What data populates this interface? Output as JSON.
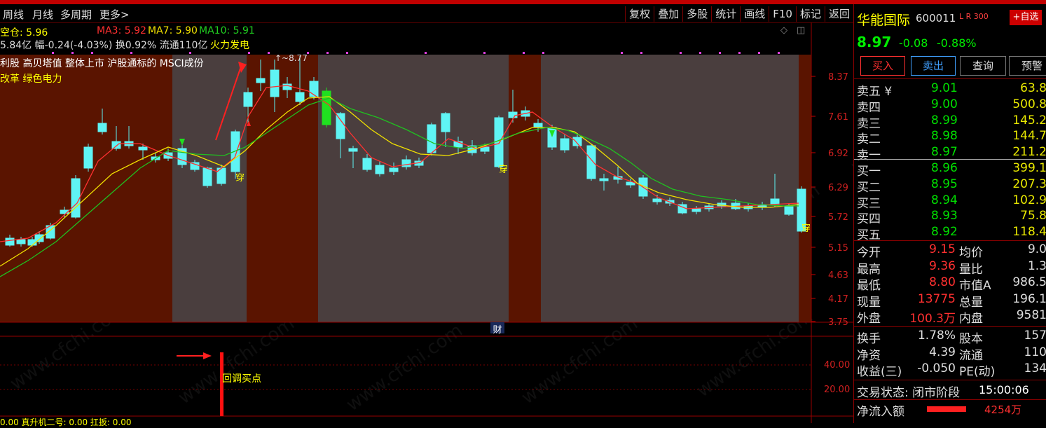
{
  "toolbar": {
    "left": [
      "周线",
      "月线",
      "多周期",
      "更多>"
    ],
    "right": [
      "复权",
      "叠加",
      "多股",
      "统计",
      "画线",
      "F10",
      "标记",
      "返回"
    ]
  },
  "info1": {
    "pos": "空仓: 5.96",
    "ma3": "MA3: 5.92",
    "ma7": "MA7: 5.90",
    "ma10": "MA10: 5.91"
  },
  "info2": {
    "text": "5.84亿 幅-0.24(-4.03%) 换0.92% 流通110亿",
    "sector": "火力发电"
  },
  "tags1": "利股 高贝塔值 整体上市 沪股通标的 MSCI成份",
  "tags2": "改革 绿色电力",
  "chart_data": {
    "type": "candlestick",
    "price_axis": [
      "8.37",
      "7.61",
      "6.92",
      "6.29",
      "5.72",
      "5.15",
      "4.63",
      "4.17",
      "3.75"
    ],
    "high_label": "8.77",
    "markers": [
      "穿",
      "穿",
      "穿"
    ],
    "finance_marker": "财",
    "indicator_axis": [
      "40.00",
      "20.00"
    ],
    "indicator_label": "回调买点",
    "bottom_indicators": "0.00  真升机二号: 0.00   扛扳: 0.00",
    "colors": {
      "up": "#ff2020",
      "down": "#5ff4f4",
      "ma3": "#ff3030",
      "ma7": "#f0e000",
      "ma10": "#20c020"
    }
  },
  "quote": {
    "name": "华能国际",
    "code": "600011",
    "flags": "L R 300",
    "add": "+自选",
    "price": "8.97",
    "change": "-0.08",
    "pct": "-0.88%",
    "buttons": [
      "买入",
      "卖出",
      "查询",
      "预警"
    ],
    "sell": [
      {
        "label": "卖五 ¥",
        "price": "9.01",
        "vol": "63.8"
      },
      {
        "label": "卖四",
        "price": "9.00",
        "vol": "500.8"
      },
      {
        "label": "卖三",
        "price": "8.99",
        "vol": "145.2"
      },
      {
        "label": "卖二",
        "price": "8.98",
        "vol": "144.7"
      },
      {
        "label": "卖一",
        "price": "8.97",
        "vol": "211.2"
      }
    ],
    "buy": [
      {
        "label": "买一",
        "price": "8.96",
        "vol": "399.1"
      },
      {
        "label": "买二",
        "price": "8.95",
        "vol": "207.3"
      },
      {
        "label": "买三",
        "price": "8.94",
        "vol": "102.9"
      },
      {
        "label": "买四",
        "price": "8.93",
        "vol": "75.8"
      },
      {
        "label": "买五",
        "price": "8.92",
        "vol": "118.4"
      }
    ],
    "stats": [
      {
        "k1": "今开",
        "v1": "9.15",
        "k2": "均价",
        "v2": "9.0"
      },
      {
        "k1": "最高",
        "v1": "9.36",
        "k2": "量比",
        "v2": "1.3"
      },
      {
        "k1": "最低",
        "v1": "8.80",
        "k2": "市值A",
        "v2": "986.5"
      },
      {
        "k1": "现量",
        "v1": "13775",
        "k2": "总量",
        "v2": "196.1"
      },
      {
        "k1": "外盘",
        "v1": "100.3万",
        "k2": "内盘",
        "v2": "9581"
      }
    ],
    "fund": [
      {
        "k1": "换手",
        "v1": "1.78%",
        "k2": "股本",
        "v2": "157"
      },
      {
        "k1": "净资",
        "v1": "4.39",
        "k2": "流通",
        "v2": "110"
      },
      {
        "k1": "收益(三)",
        "v1": "-0.050",
        "k2": "PE(动)",
        "v2": "134"
      }
    ],
    "status_label": "交易状态: 闭市阶段",
    "status_time": "15:00:06",
    "netflow_label": "净流入额",
    "netflow_val": "4254万"
  },
  "watermark": "www.cfchi.com"
}
